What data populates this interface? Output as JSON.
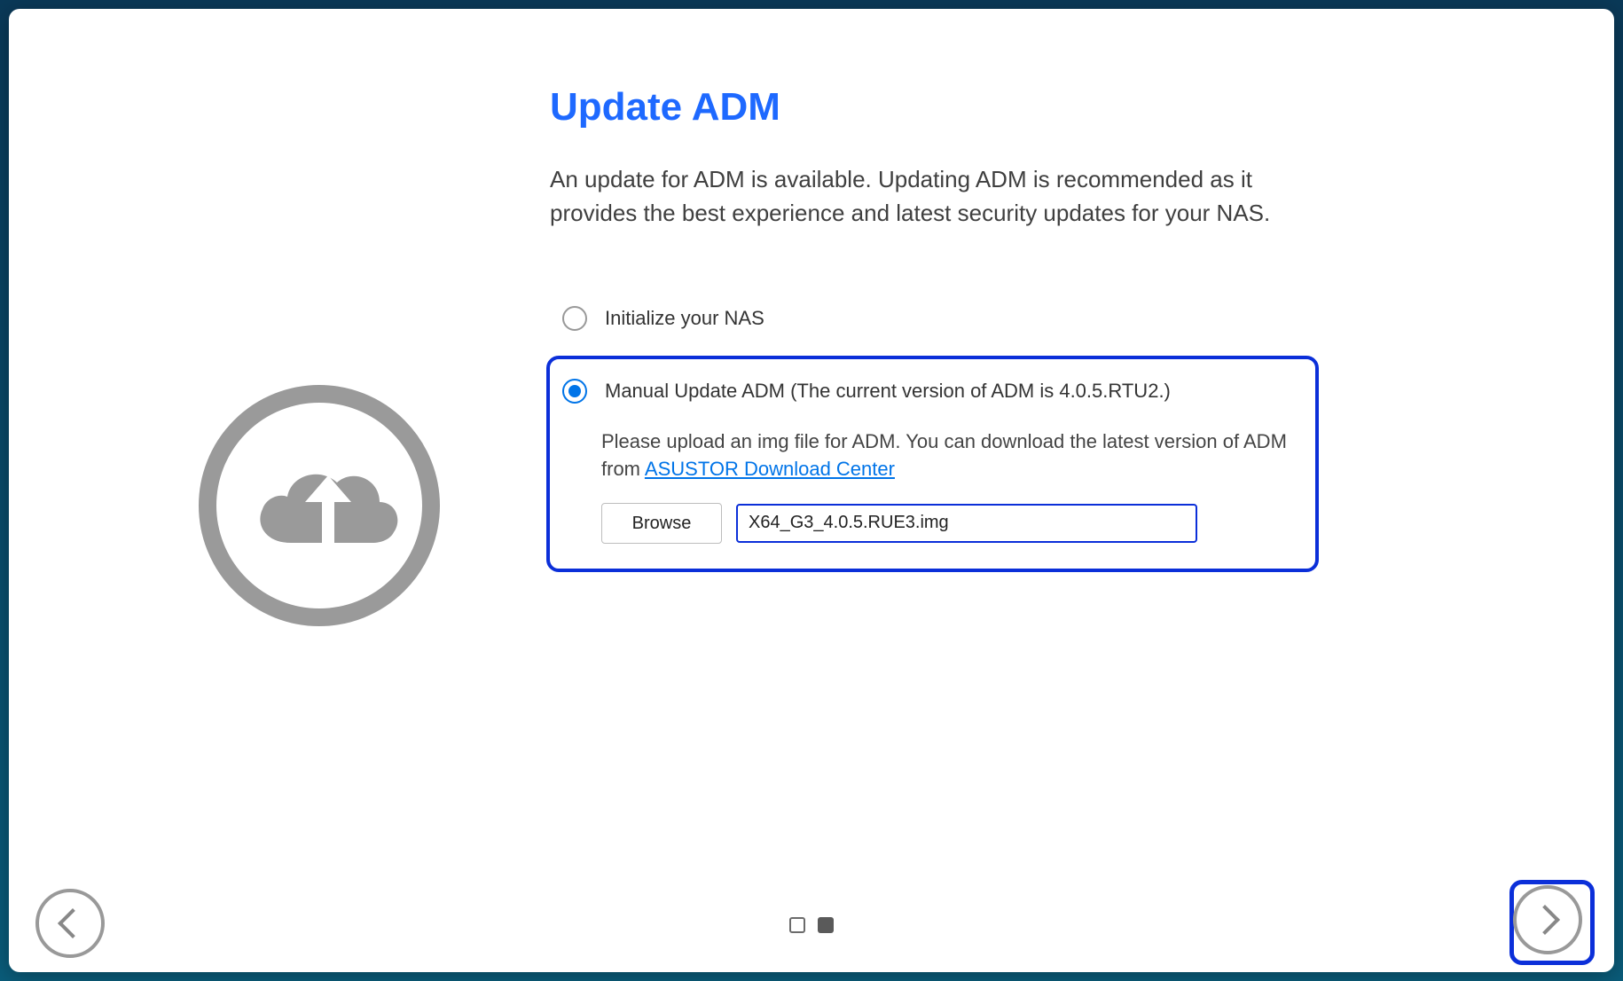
{
  "header": {
    "title": "Update ADM",
    "description": "An update for ADM is available. Updating ADM is recommended as it provides the best experience and latest security updates for your NAS."
  },
  "options": {
    "init_label": "Initialize your NAS",
    "manual_label_prefix": "Manual Update ADM (The current version of ADM is ",
    "current_version": "4.0.5.RTU2",
    "manual_label_suffix": ".)",
    "manual_instruction": "Please upload an img file for ADM. You can download the latest version of ADM from ",
    "download_link_label": "ASUSTOR Download Center",
    "browse_label": "Browse",
    "selected_file": "X64_G3_4.0.5.RUE3.img"
  }
}
